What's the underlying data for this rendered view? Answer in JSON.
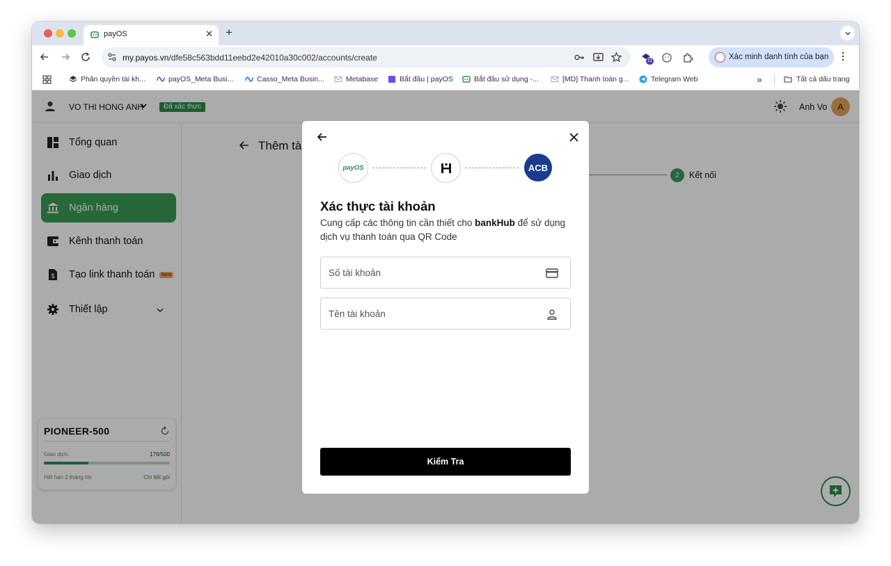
{
  "browser": {
    "tab_title": "payOS",
    "tab_close": "✕",
    "new_tab": "+",
    "url_host": "my.payos.vn",
    "url_path": "/dfe58c563bdd11eebd2e42010a30c002/accounts/create",
    "extension_badge": "11",
    "profile_label": "Xác minh danh tính của bạn"
  },
  "bookmarks": [
    {
      "label": "Phân quyền tài kh...",
      "icon": "layers-icon"
    },
    {
      "label": "payOS_Meta Busi...",
      "icon": "meta-icon"
    },
    {
      "label": "Casso_Meta Busin...",
      "icon": "meta-icon"
    },
    {
      "label": "Metabase",
      "icon": "mail-icon"
    },
    {
      "label": "Bắt đầu | payOS",
      "icon": "square-icon"
    },
    {
      "label": "Bắt đầu sử dụng -...",
      "icon": "payos-icon"
    },
    {
      "label": "[MD] Thanh toán g...",
      "icon": "mail-icon"
    },
    {
      "label": "Telegram Web",
      "icon": "telegram-icon"
    }
  ],
  "bookmarks_overflow": "»",
  "bookmarks_all": "Tất cả dấu trang",
  "header": {
    "username": "VO THI HONG ANH",
    "verified_badge": "Đã xác thực",
    "account_name": "Anh Vo",
    "avatar_letter": "A"
  },
  "sidebar": {
    "items": [
      {
        "label": "Tổng quan",
        "icon": "dashboard-icon"
      },
      {
        "label": "Giao dịch",
        "icon": "bar-chart-icon"
      },
      {
        "label": "Ngân hàng",
        "icon": "bank-icon",
        "active": true
      },
      {
        "label": "Kênh thanh toán",
        "icon": "wallet-icon"
      },
      {
        "label": "Tạo link thanh toán",
        "icon": "invoice-icon",
        "badge": "Beta"
      },
      {
        "label": "Thiết lập",
        "icon": "gear-icon"
      }
    ],
    "plan": {
      "name": "PIONEER-500",
      "usage_label": "Giao dịch:",
      "usage_count": "176/500",
      "usage_fraction": 0.352,
      "expiry": "Hết hạn 2 tháng tới",
      "detail_link": "Chi tiết gói"
    }
  },
  "content": {
    "title": "Thêm tà",
    "step_number": "2",
    "step_label": "Kết nối"
  },
  "modal": {
    "logos": {
      "payos": "payOS",
      "acb": "ACB"
    },
    "title": "Xác thực tài khoản",
    "desc_before": "Cung cấp các thông tin cần thiết cho ",
    "desc_bold": "bankHub",
    "desc_after": " để sử dụng dịch vụ thanh toán qua QR Code",
    "account_number_placeholder": "Số tài khoản",
    "account_name_placeholder": "Tên tài khoản",
    "submit_label": "Kiểm Tra"
  },
  "colors": {
    "brand_green": "#3a9b55",
    "acb_blue": "#1a3c8f",
    "overlay": "rgba(0,0,0,0.33)"
  }
}
